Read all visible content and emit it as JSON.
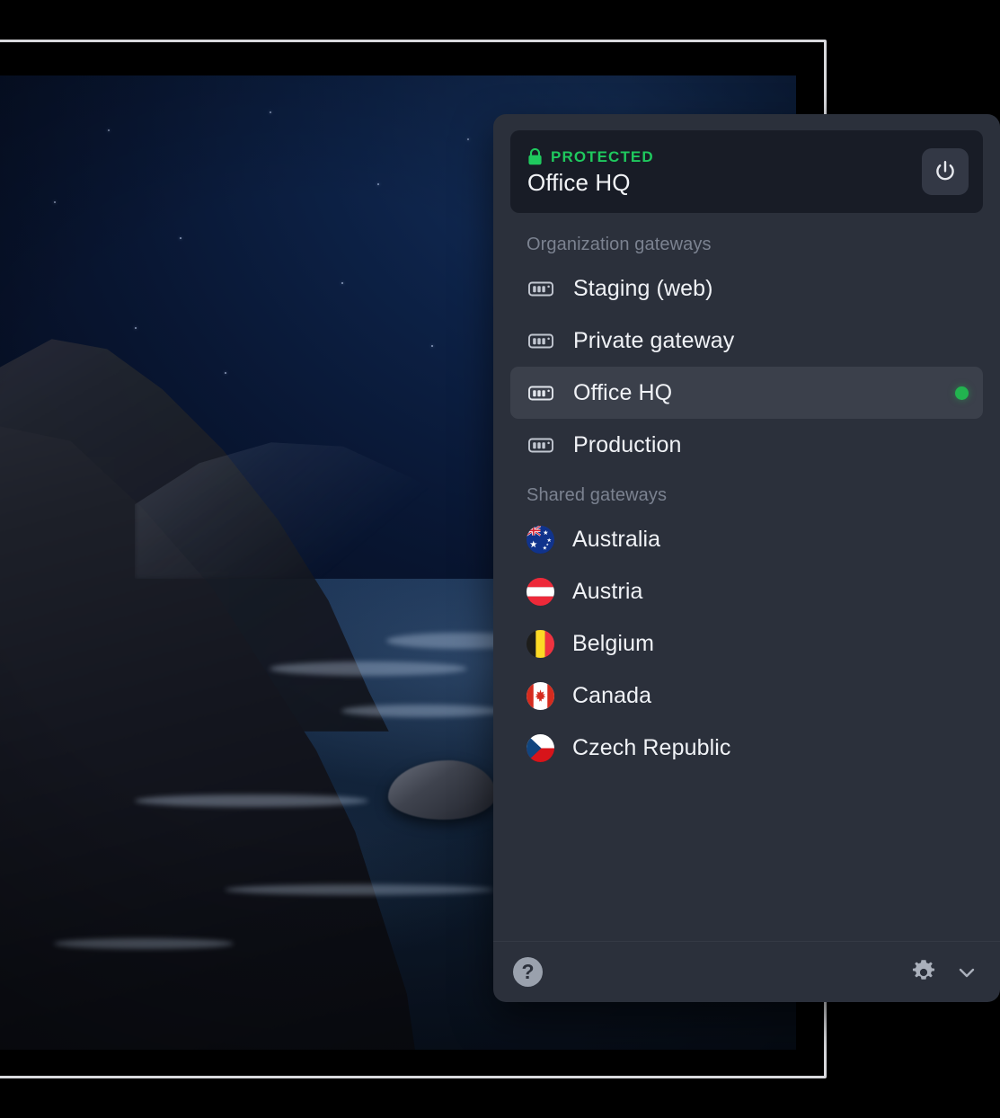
{
  "desktop": {
    "wallpaper_description": "night coastal cliff over ocean",
    "frame_color": "#d8d9dd"
  },
  "panel": {
    "background_color": "#2b303b",
    "header": {
      "status_label": "PROTECTED",
      "status_color": "#1fc95e",
      "lock_icon": "lock-icon",
      "connection_name": "Office HQ",
      "power_icon": "power-icon"
    },
    "groups": [
      {
        "label": "Organization gateways",
        "items": [
          {
            "label": "Staging (web)",
            "icon": "server-icon",
            "selected": false,
            "connected": false
          },
          {
            "label": "Private gateway",
            "icon": "server-icon",
            "selected": false,
            "connected": false
          },
          {
            "label": "Office HQ",
            "icon": "server-icon",
            "selected": true,
            "connected": true
          },
          {
            "label": "Production",
            "icon": "server-icon",
            "selected": false,
            "connected": false
          }
        ]
      },
      {
        "label": "Shared gateways",
        "items": [
          {
            "label": "Australia",
            "icon": "flag-australia",
            "selected": false,
            "connected": false
          },
          {
            "label": "Austria",
            "icon": "flag-austria",
            "selected": false,
            "connected": false
          },
          {
            "label": "Belgium",
            "icon": "flag-belgium",
            "selected": false,
            "connected": false
          },
          {
            "label": "Canada",
            "icon": "flag-canada",
            "selected": false,
            "connected": false
          },
          {
            "label": "Czech Republic",
            "icon": "flag-czech-republic",
            "selected": false,
            "connected": false
          }
        ]
      }
    ],
    "footer": {
      "help_label": "?",
      "help_icon": "help-icon",
      "settings_icon": "gear-icon",
      "expand_icon": "chevron-down-icon"
    },
    "accent_colors": {
      "status_green": "#1fc95e",
      "connected_dot": "#22b34f",
      "selected_row": "#3b404b",
      "header_card": "#181c26"
    }
  }
}
